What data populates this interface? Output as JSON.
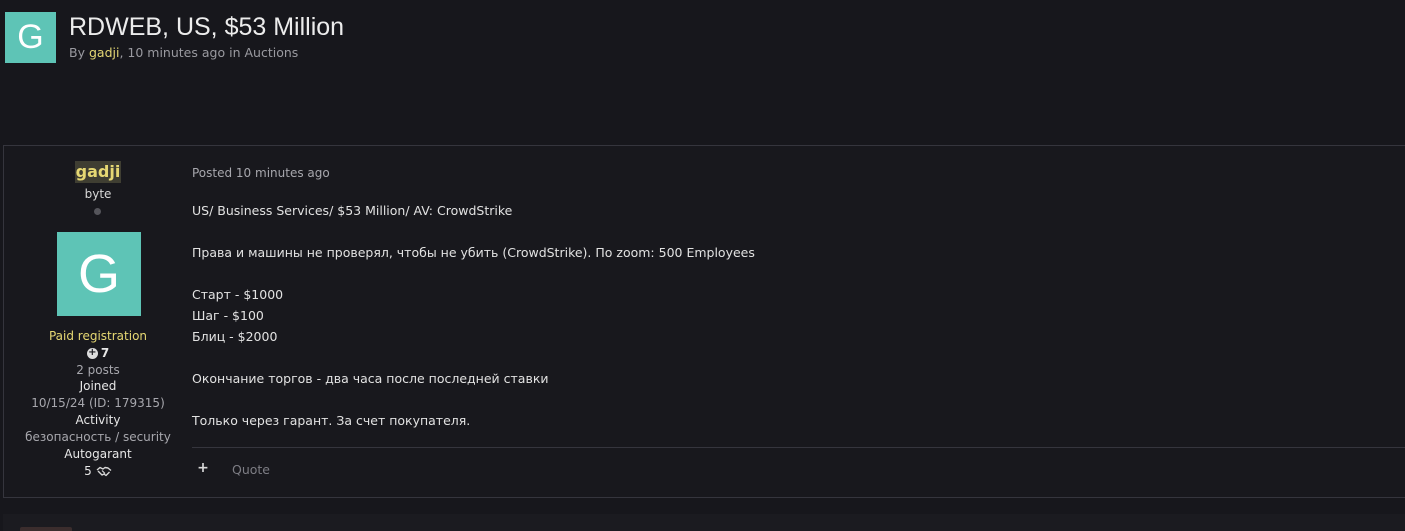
{
  "topic": {
    "avatar_letter": "G",
    "title": "RDWEB, US, $53 Million",
    "meta_by": "By",
    "meta_author": "gadji",
    "meta_time": "10 minutes ago",
    "meta_in": "in",
    "meta_forum": "Auctions"
  },
  "author": {
    "name": "gadji",
    "rank": "byte",
    "avatar_letter": "G",
    "group": "Paid registration",
    "reputation": "7",
    "posts": "2 posts",
    "joined_label": "Joined",
    "joined_value": "10/15/24 (ID: 179315)",
    "activity_label": "Activity",
    "activity_value": "безопасность / security",
    "autogarant_label": "Autogarant",
    "autogarant_value": "5"
  },
  "post": {
    "posted": "Posted 10 minutes ago",
    "lines": [
      "US/ Business Services/ $53 Million/ AV: CrowdStrike",
      "Права и машины не проверял, чтобы не убить (CrowdStrike). По zoom: 500 Employees",
      "Старт - $1000",
      "Шаг - $100",
      "Блиц - $2000",
      "Окончание торгов - два часа после последней ставки",
      "Только через гарант. За счет покупателя."
    ],
    "plus_label": "+",
    "quote_label": "Quote"
  },
  "colors": {
    "background": "#17171c",
    "avatar": "#5ec4b6",
    "author_highlight": "#e6d873",
    "border": "#35353d"
  },
  "icons": [
    "plus-circle-icon",
    "handshake-icon",
    "plus-icon",
    "online-status-icon"
  ]
}
